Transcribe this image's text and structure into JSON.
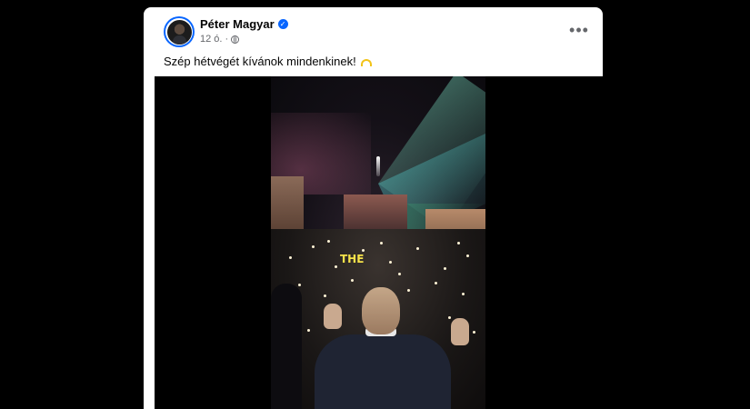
{
  "post": {
    "author": "Péter Magyar",
    "time": "12 ó.",
    "meta_separator": "·",
    "privacy_icon": "globe-icon",
    "verified_icon": "verified-badge-icon",
    "more_icon": "more-options-icon",
    "more_label": "•••",
    "text": "Szép hétvégét kívánok mindenkinek!",
    "emoji": "rainbow-emoji-icon"
  },
  "video": {
    "caption": "THE"
  },
  "colors": {
    "page_background": "#000000",
    "card_background": "#ffffff",
    "verified_blue": "#0866ff",
    "meta_gray": "#65676b",
    "caption_yellow": "#f6e24a"
  }
}
